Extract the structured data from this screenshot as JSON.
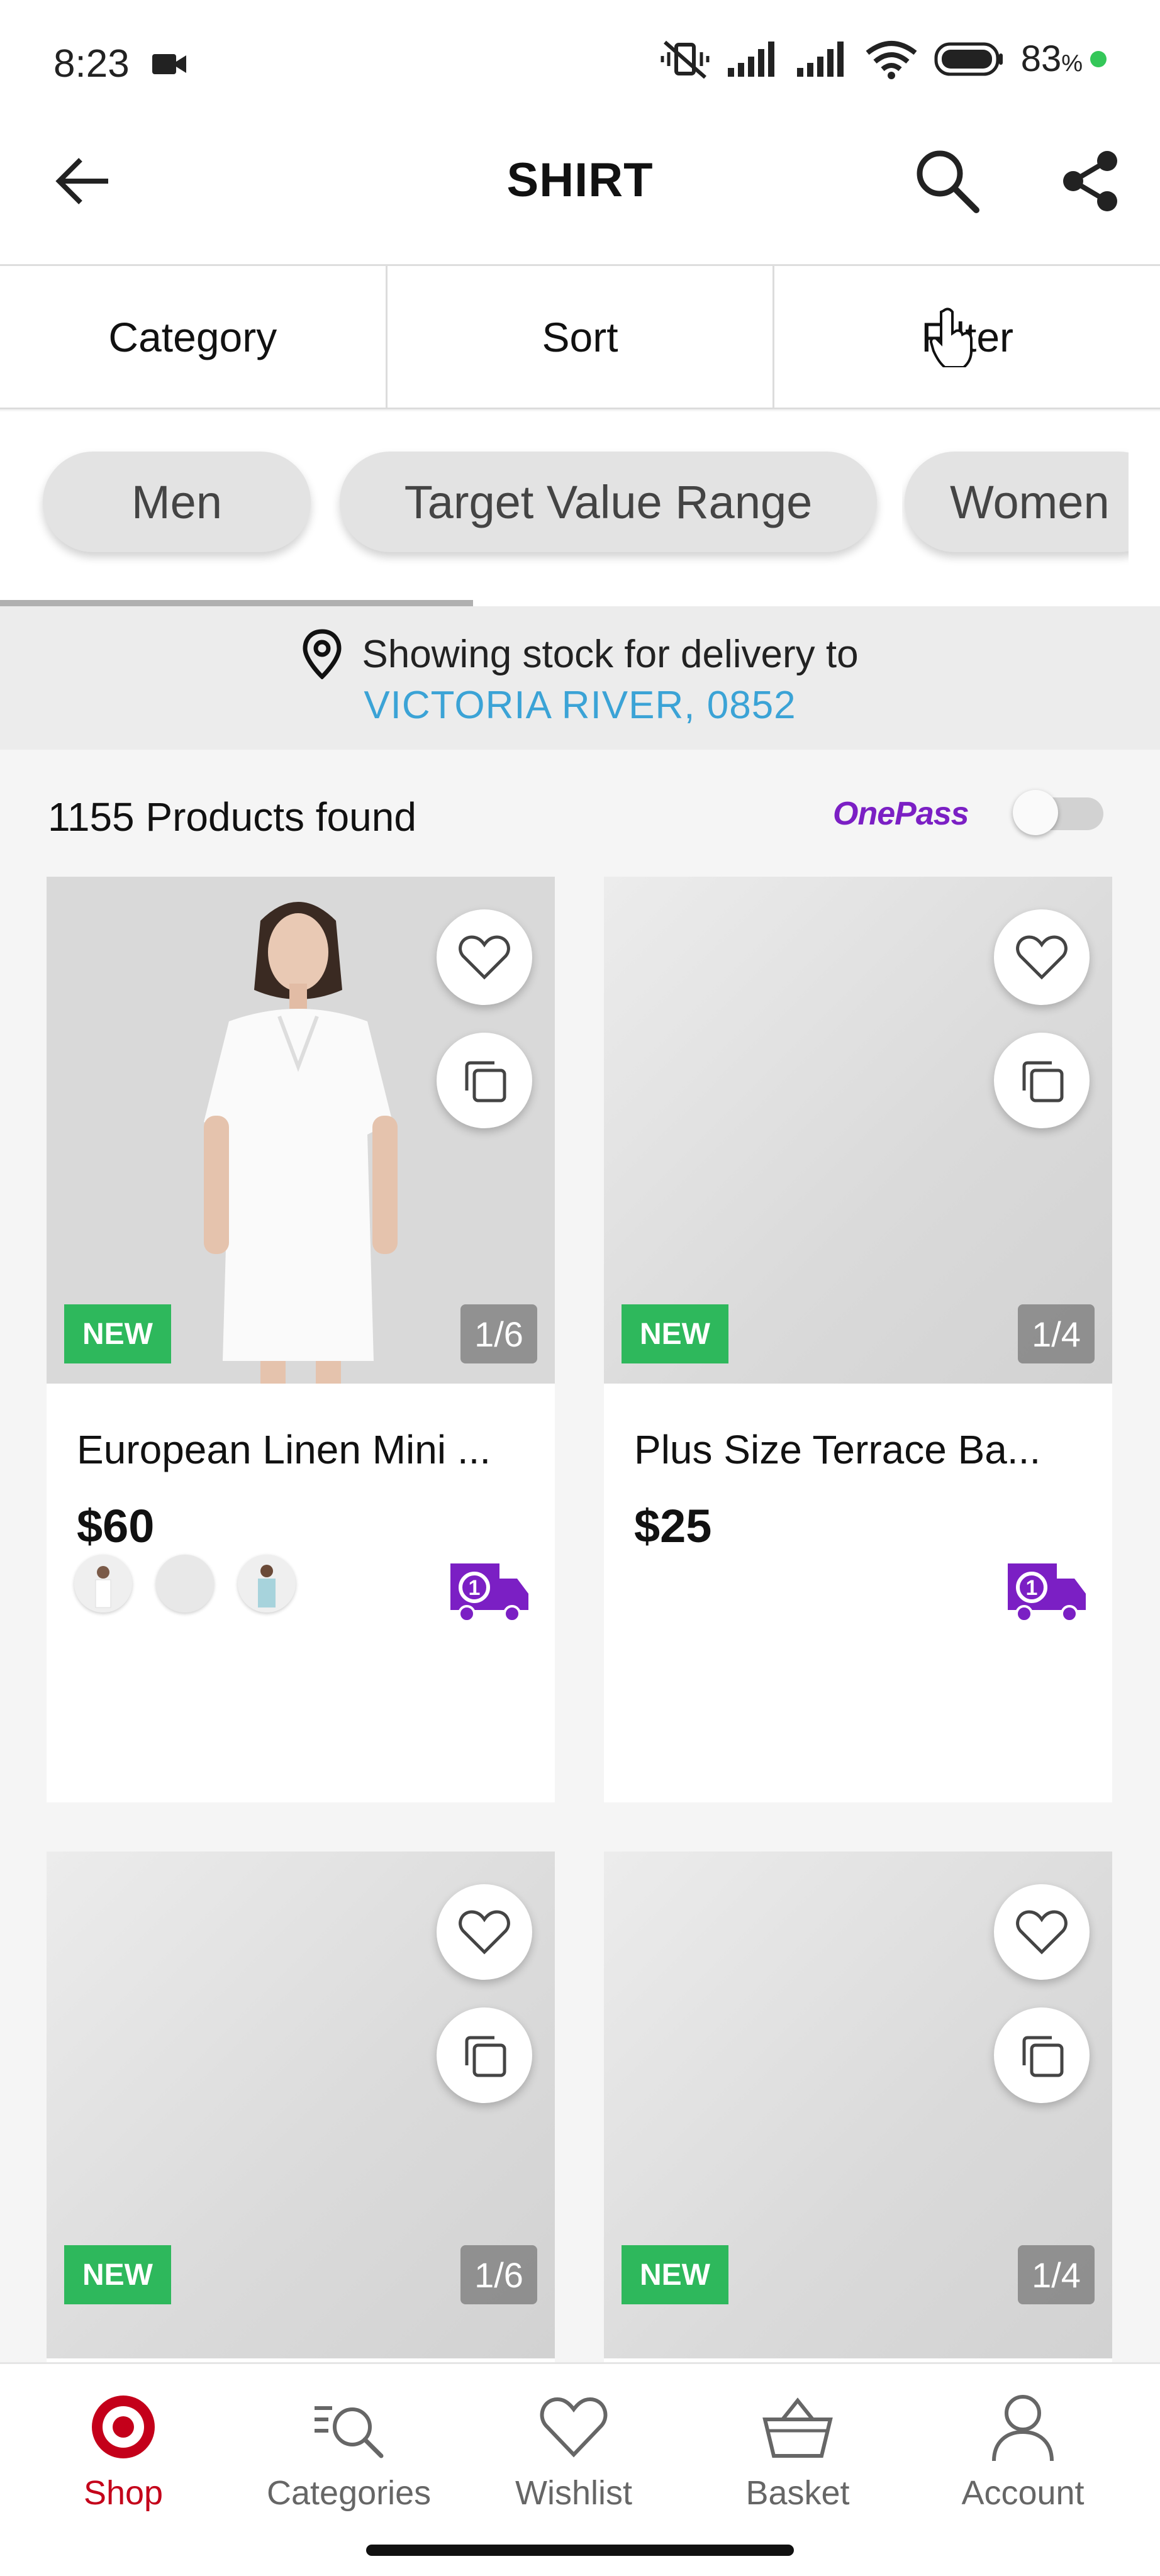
{
  "status_bar": {
    "time": "8:23",
    "battery": "83",
    "battery_unit": "%"
  },
  "header": {
    "title": "SHIRT"
  },
  "tabs": [
    {
      "label": "Category"
    },
    {
      "label": "Sort"
    },
    {
      "label": "Filter"
    }
  ],
  "chips": [
    {
      "label": "Men"
    },
    {
      "label": "Target Value Range"
    },
    {
      "label": "Women"
    }
  ],
  "chip_scroll_progress": 0.41,
  "delivery": {
    "line1": "Showing stock for delivery to",
    "location": "VICTORIA RIVER, 0852"
  },
  "results": {
    "count_text": "1155 Products found",
    "onepass_label": "OnePass",
    "onepass_enabled": false
  },
  "products": [
    {
      "name": "European Linen Mini ...",
      "price": "$60",
      "badge": "NEW",
      "image_counter": "1/6",
      "swatches": 3
    },
    {
      "name": "Plus Size Terrace Ba...",
      "price": "$25",
      "badge": "NEW",
      "image_counter": "1/4",
      "swatches": 0
    },
    {
      "name": "",
      "price": "",
      "badge": "NEW",
      "image_counter": "1/6",
      "swatches": 0
    },
    {
      "name": "",
      "price": "",
      "badge": "NEW",
      "image_counter": "1/4",
      "swatches": 0
    }
  ],
  "bottom_nav": [
    {
      "label": "Shop",
      "icon": "target-logo-icon",
      "active": true
    },
    {
      "label": "Categories",
      "icon": "categories-search-icon",
      "active": false
    },
    {
      "label": "Wishlist",
      "icon": "heart-icon",
      "active": false
    },
    {
      "label": "Basket",
      "icon": "basket-icon",
      "active": false
    },
    {
      "label": "Account",
      "icon": "person-icon",
      "active": false
    }
  ],
  "colors": {
    "brand_red": "#c4001a",
    "new_badge": "#2eb85c",
    "link_blue": "#3ba3d6",
    "onepass_purple": "#7b1fc4"
  }
}
